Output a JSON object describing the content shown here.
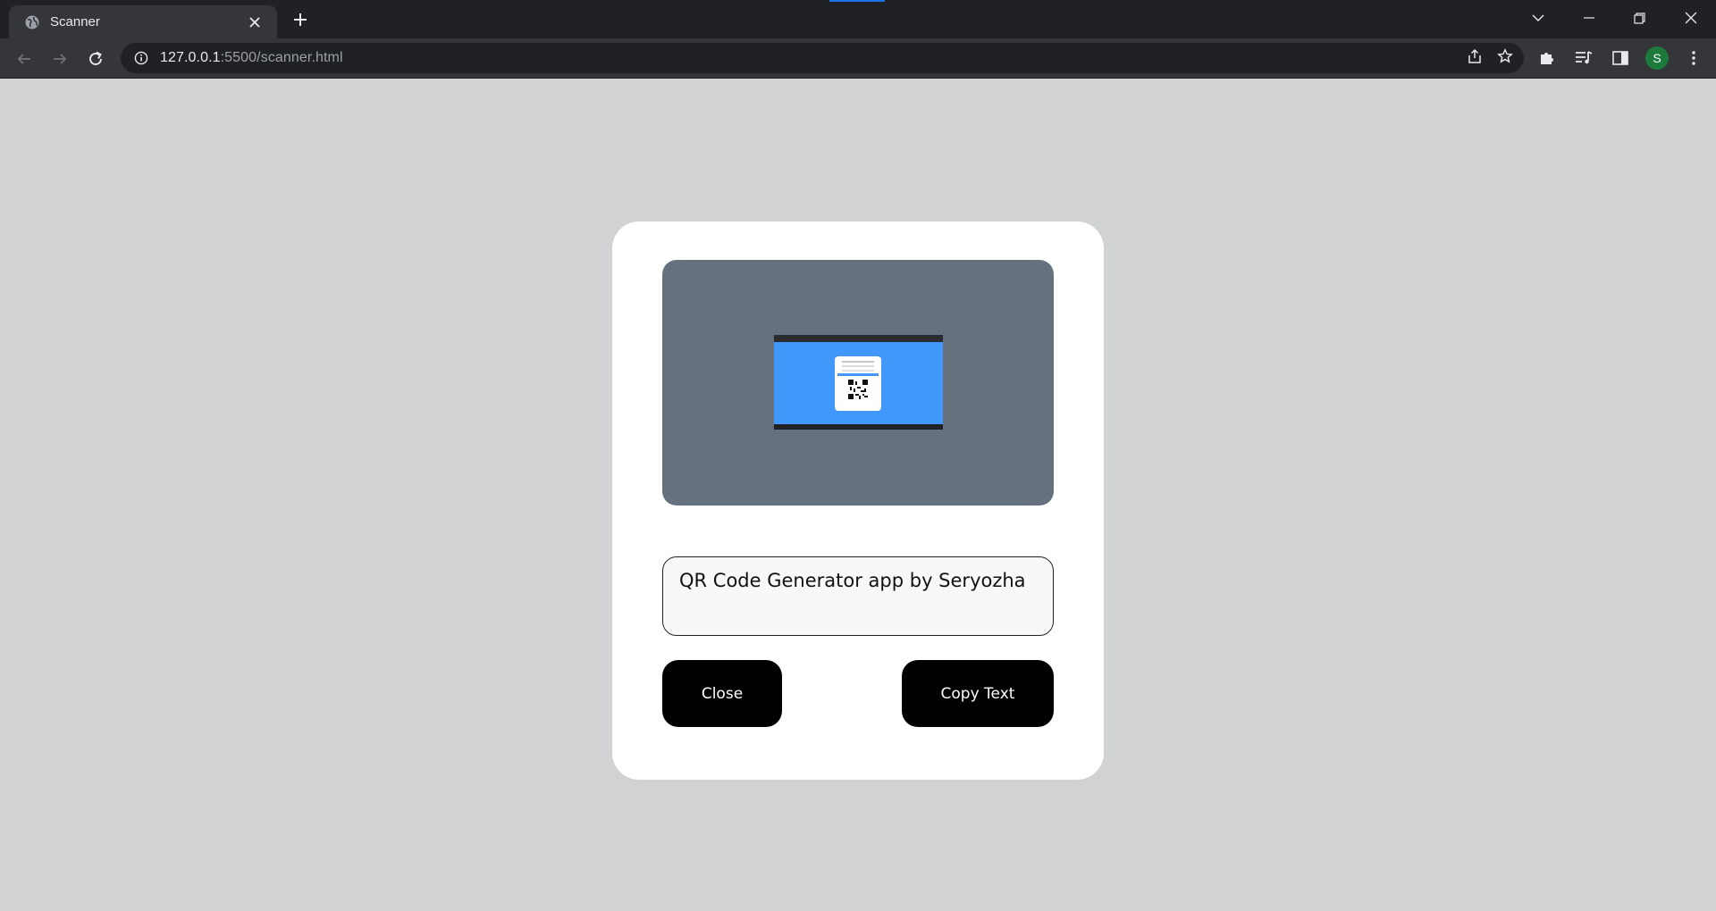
{
  "browser": {
    "tab": {
      "title": "Scanner",
      "favicon": "globe-icon"
    },
    "address_bar": {
      "host": "127.0.0.1",
      "path": ":5500/scanner.html"
    },
    "profile_initial": "S",
    "colors": {
      "tabstrip": "#202124",
      "toolbar": "#35363a",
      "avatar": "#1e7a3a"
    }
  },
  "scanner": {
    "result_text": "QR Code Generator app by Seryozha",
    "close_label": "Close",
    "copy_label": "Copy Text",
    "colors": {
      "background": "#d1d2d4",
      "card": "#ffffff",
      "preview": "#66717f",
      "button": "#000000"
    }
  }
}
